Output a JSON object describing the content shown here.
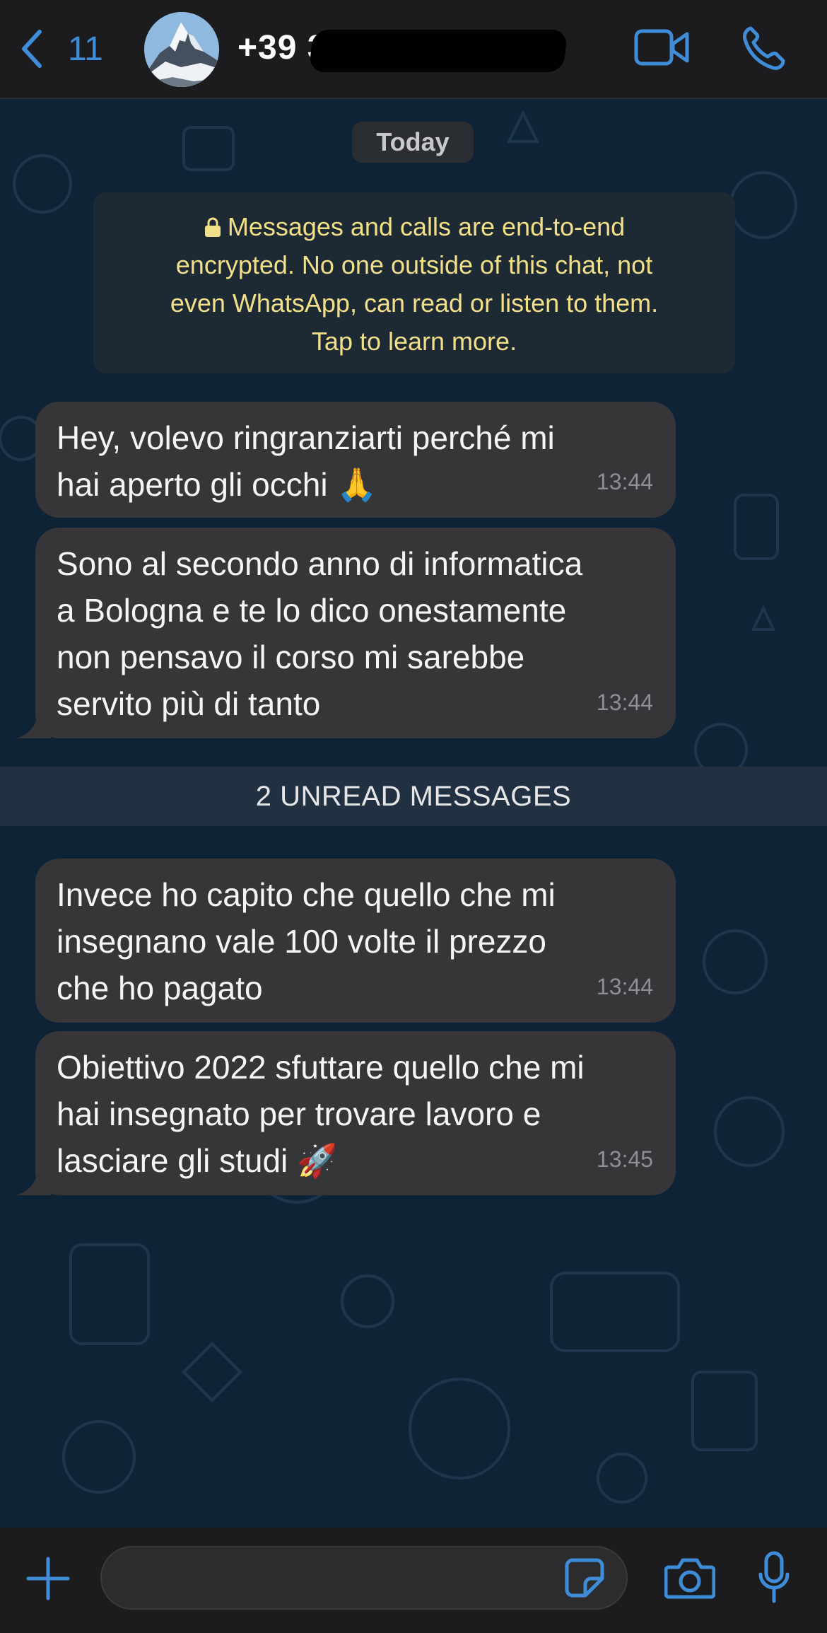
{
  "header": {
    "back_count": "11",
    "contact_name": "+39 3",
    "icons": {
      "back": "chevron-left-icon",
      "video": "video-camera-icon",
      "call": "phone-icon"
    },
    "accent_color": "#3f8cd8"
  },
  "chat": {
    "day_label": "Today",
    "encryption_notice": {
      "line1": "Messages and calls are end-to-end",
      "line2": "encrypted. No one outside of this chat, not",
      "line3": "even WhatsApp, can read or listen to them.",
      "line4": "Tap to learn more.",
      "icon": "lock-icon"
    },
    "unread_divider": "2 UNREAD MESSAGES",
    "messages": [
      {
        "lines": [
          "Hey, volevo ringranziarti perché mi",
          "hai aperto gli occhi 🙏"
        ],
        "time": "13:44"
      },
      {
        "lines": [
          "Sono al secondo anno di informatica",
          "a Bologna e te lo dico onestamente",
          "non pensavo il corso mi sarebbe",
          "servito più di tanto"
        ],
        "time": "13:44"
      },
      {
        "lines": [
          "Invece ho capito che quello che mi",
          "insegnano vale 100 volte il prezzo",
          "che ho pagato"
        ],
        "time": "13:44"
      },
      {
        "lines": [
          "Obiettivo 2022 sfuttare quello che mi",
          "hai insegnato per trovare lavoro e",
          "lasciare gli studi  🚀"
        ],
        "time": "13:45"
      }
    ]
  },
  "composer": {
    "input_value": "",
    "icons": {
      "plus": "plus-icon",
      "sticker": "sticker-icon",
      "camera": "camera-icon",
      "mic": "microphone-icon"
    }
  }
}
